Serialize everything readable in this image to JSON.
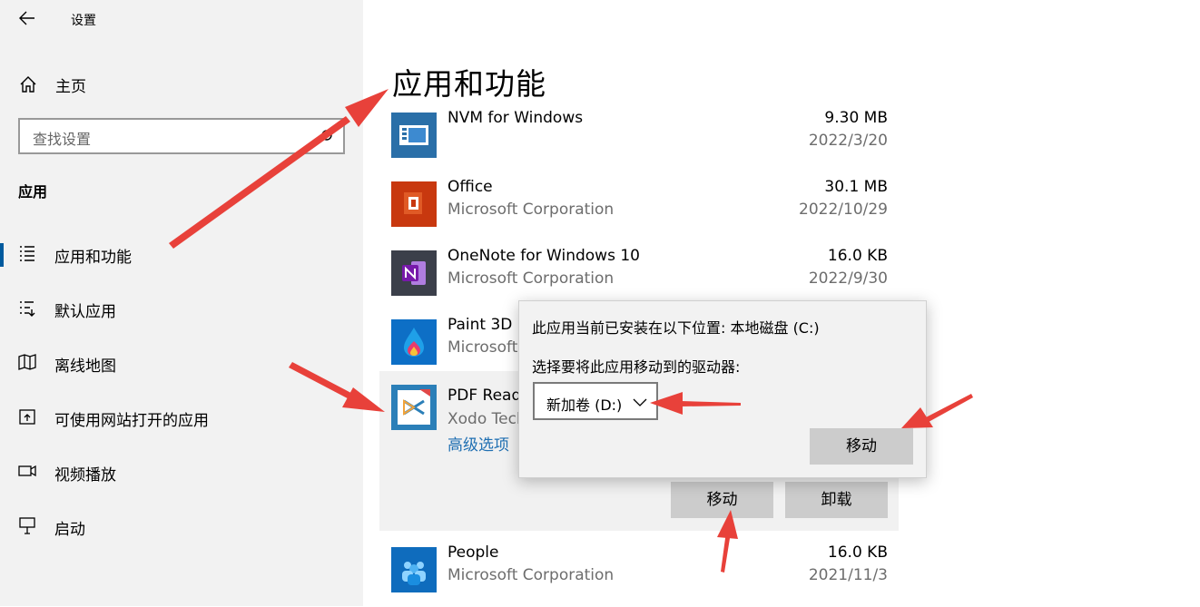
{
  "window": {
    "title": "设置"
  },
  "sidebar": {
    "home_label": "主页",
    "search_placeholder": "查找设置",
    "section_heading": "应用",
    "items": [
      {
        "label": "应用和功能",
        "icon": "apps-features-icon",
        "selected": true
      },
      {
        "label": "默认应用",
        "icon": "default-apps-icon"
      },
      {
        "label": "离线地图",
        "icon": "offline-maps-icon"
      },
      {
        "label": "可使用网站打开的应用",
        "icon": "apps-for-websites-icon"
      },
      {
        "label": "视频播放",
        "icon": "video-playback-icon"
      },
      {
        "label": "启动",
        "icon": "startup-icon"
      }
    ]
  },
  "main": {
    "title": "应用和功能",
    "apps": [
      {
        "name": "NVM for Windows",
        "publisher": "",
        "size": "9.30 MB",
        "date": "2022/3/20"
      },
      {
        "name": "Office",
        "publisher": "Microsoft Corporation",
        "size": "30.1 MB",
        "date": "2022/10/29"
      },
      {
        "name": "OneNote for Windows 10",
        "publisher": "Microsoft Corporation",
        "size": "16.0 KB",
        "date": "2022/9/30"
      },
      {
        "name": "Paint 3D",
        "publisher": "Microsoft"
      },
      {
        "name": "PDF Reade",
        "publisher": "Xodo Tech",
        "advanced_options": "高级选项",
        "move_button": "移动",
        "uninstall_button": "卸载"
      },
      {
        "name": "People",
        "publisher": "Microsoft Corporation",
        "size": "16.0 KB",
        "date": "2021/11/3"
      }
    ]
  },
  "move_flyout": {
    "location_text": "此应用当前已安装在以下位置: 本地磁盘 (C:)",
    "prompt_text": "选择要将此应用移动到的驱动器:",
    "selected_drive": "新加卷 (D:)",
    "move_button": "移动"
  },
  "colors": {
    "accent": "#005a9e",
    "annotation_arrow": "#e8413a"
  }
}
